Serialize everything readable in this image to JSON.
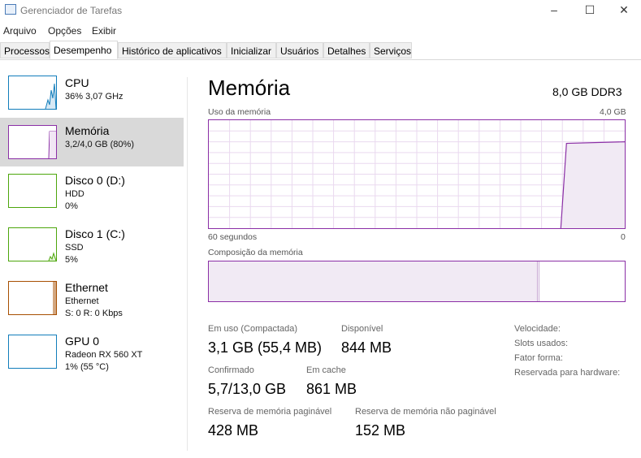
{
  "window": {
    "title": "Gerenciador de Tarefas"
  },
  "menu": [
    "Arquivo",
    "Opções",
    "Exibir"
  ],
  "tabs": [
    "Processos",
    "Desempenho",
    "Histórico de aplicativos",
    "Inicializar",
    "Usuários",
    "Detalhes",
    "Serviços"
  ],
  "active_tab": "Desempenho",
  "sidebar": [
    {
      "title": "CPU",
      "line1": "36% 3,07 GHz",
      "line2": "",
      "color": "#117dbb"
    },
    {
      "title": "Memória",
      "line1": "3,2/4,0 GB (80%)",
      "line2": "",
      "color": "#8b2fa6",
      "selected": true
    },
    {
      "title": "Disco 0 (D:)",
      "line1": "HDD",
      "line2": "0%",
      "color": "#4da60c"
    },
    {
      "title": "Disco 1 (C:)",
      "line1": "SSD",
      "line2": "5%",
      "color": "#4da60c"
    },
    {
      "title": "Ethernet",
      "line1": "Ethernet",
      "line2": "S: 0 R: 0 Kbps",
      "color": "#a74f01"
    },
    {
      "title": "GPU 0",
      "line1": "Radeon RX 560 XT",
      "line2": "1% (55 °C)",
      "color": "#117dbb"
    }
  ],
  "main": {
    "title": "Memória",
    "mem_type": "8,0 GB DDR3",
    "usage_label": "Uso da memória",
    "usage_max": "4,0 GB",
    "time_left": "60 segundos",
    "time_right": "0",
    "composition_label": "Composição da memória",
    "stats": {
      "in_use_label": "Em uso (Compactada)",
      "in_use_value": "3,1 GB (55,4 MB)",
      "available_label": "Disponível",
      "available_value": "844 MB",
      "committed_label": "Confirmado",
      "committed_value": "5,7/13,0 GB",
      "cached_label": "Em cache",
      "cached_value": "861 MB",
      "paged_label": "Reserva de memória paginável",
      "paged_value": "428 MB",
      "nonpaged_label": "Reserva de memória não paginável",
      "nonpaged_value": "152 MB"
    },
    "right_labels": {
      "speed": "Velocidade:",
      "slots": "Slots usados:",
      "form": "Fator forma:",
      "reserved": "Reservada para hardware:"
    }
  },
  "colors": {
    "memory": "#8b2fa6",
    "selected_bg": "#d9d9d9"
  }
}
